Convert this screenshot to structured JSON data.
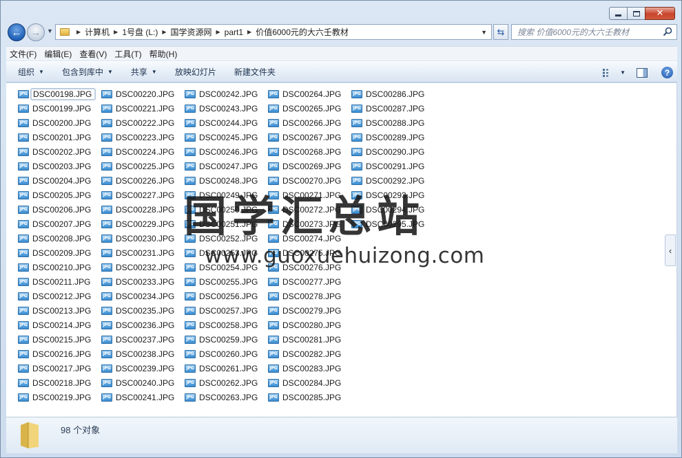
{
  "window": {
    "minimize_label": "–",
    "maximize_label": "□",
    "close_label": "✕"
  },
  "nav": {
    "breadcrumbs": [
      "计算机",
      "1号盘 (L:)",
      "国学资源网",
      "part1",
      "价值6000元的大六壬教材"
    ],
    "search_placeholder": "搜索 价值6000元的大六壬教材"
  },
  "menubar": {
    "items": [
      "文件(F)",
      "编辑(E)",
      "查看(V)",
      "工具(T)",
      "帮助(H)"
    ]
  },
  "commandbar": {
    "organize": "组织",
    "include_in_library": "包含到库中",
    "share": "共享",
    "slideshow": "放映幻灯片",
    "new_folder": "新建文件夹",
    "help": "?"
  },
  "files": {
    "icon_label": "JPG",
    "columns": [
      [
        "DSC00198.JPG",
        "DSC00199.JPG",
        "DSC00200.JPG",
        "DSC00201.JPG",
        "DSC00202.JPG",
        "DSC00203.JPG",
        "DSC00204.JPG",
        "DSC00205.JPG",
        "DSC00206.JPG",
        "DSC00207.JPG",
        "DSC00208.JPG",
        "DSC00209.JPG",
        "DSC00210.JPG",
        "DSC00211.JPG",
        "DSC00212.JPG",
        "DSC00213.JPG",
        "DSC00214.JPG",
        "DSC00215.JPG",
        "DSC00216.JPG",
        "DSC00217.JPG",
        "DSC00218.JPG",
        "DSC00219.JPG"
      ],
      [
        "DSC00220.JPG",
        "DSC00221.JPG",
        "DSC00222.JPG",
        "DSC00223.JPG",
        "DSC00224.JPG",
        "DSC00225.JPG",
        "DSC00226.JPG",
        "DSC00227.JPG",
        "DSC00228.JPG",
        "DSC00229.JPG",
        "DSC00230.JPG",
        "DSC00231.JPG",
        "DSC00232.JPG",
        "DSC00233.JPG",
        "DSC00234.JPG",
        "DSC00235.JPG",
        "DSC00236.JPG",
        "DSC00237.JPG",
        "DSC00238.JPG",
        "DSC00239.JPG",
        "DSC00240.JPG",
        "DSC00241.JPG"
      ],
      [
        "DSC00242.JPG",
        "DSC00243.JPG",
        "DSC00244.JPG",
        "DSC00245.JPG",
        "DSC00246.JPG",
        "DSC00247.JPG",
        "DSC00248.JPG",
        "DSC00249.JPG",
        "DSC00250.JPG",
        "DSC00251.JPG",
        "DSC00252.JPG",
        "DSC00253.JPG",
        "DSC00254.JPG",
        "DSC00255.JPG",
        "DSC00256.JPG",
        "DSC00257.JPG",
        "DSC00258.JPG",
        "DSC00259.JPG",
        "DSC00260.JPG",
        "DSC00261.JPG",
        "DSC00262.JPG",
        "DSC00263.JPG"
      ],
      [
        "DSC00264.JPG",
        "DSC00265.JPG",
        "DSC00266.JPG",
        "DSC00267.JPG",
        "DSC00268.JPG",
        "DSC00269.JPG",
        "DSC00270.JPG",
        "DSC00271.JPG",
        "DSC00272.JPG",
        "DSC00273.JPG",
        "DSC00274.JPG",
        "DSC00275.JPG",
        "DSC00276.JPG",
        "DSC00277.JPG",
        "DSC00278.JPG",
        "DSC00279.JPG",
        "DSC00280.JPG",
        "DSC00281.JPG",
        "DSC00282.JPG",
        "DSC00283.JPG",
        "DSC00284.JPG",
        "DSC00285.JPG"
      ],
      [
        "DSC00286.JPG",
        "DSC00287.JPG",
        "DSC00288.JPG",
        "DSC00289.JPG",
        "DSC00290.JPG",
        "DSC00291.JPG",
        "DSC00292.JPG",
        "DSC00293.JPG",
        "DSC00294.JPG",
        "DSC00295.JPG"
      ]
    ],
    "selected": "DSC00198.JPG"
  },
  "watermark": {
    "title": "国学汇总站",
    "url": "www.guoxuehuizong.com"
  },
  "details": {
    "count_text": "98 个对象"
  },
  "side_handle": "‹"
}
